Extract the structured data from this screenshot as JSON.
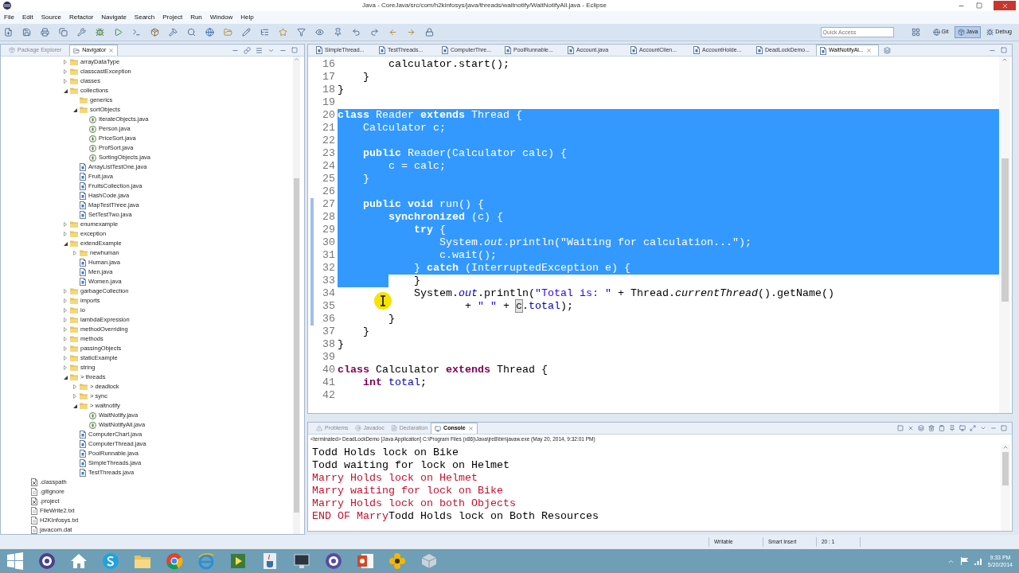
{
  "window": {
    "title": "Java - CoreJava/src/com/h2kinfosys/java/threads/waitnotify/WaitNotifyAll.java - Eclipse"
  },
  "menu": [
    "File",
    "Edit",
    "Source",
    "Refactor",
    "Navigate",
    "Search",
    "Project",
    "Run",
    "Window",
    "Help"
  ],
  "toolbar": {
    "quick_access": {
      "placeholder": "Quick Access"
    },
    "perspectives": [
      {
        "label": "Git",
        "selected": false
      },
      {
        "label": "Java",
        "selected": true
      },
      {
        "label": "Debug",
        "selected": false
      }
    ]
  },
  "navigator": {
    "tabs": [
      {
        "label": "Package Explorer",
        "selected": false
      },
      {
        "label": "Navigator",
        "selected": true
      }
    ],
    "folders": [
      {
        "label": "arrayDataType",
        "kind": "folder",
        "expanded": false
      },
      {
        "label": "classcastException",
        "kind": "folder",
        "expanded": false
      },
      {
        "label": "classes",
        "kind": "folder",
        "expanded": false
      },
      {
        "label": "collections",
        "kind": "folder",
        "expanded": true,
        "children": [
          {
            "label": "generics",
            "kind": "folder"
          },
          {
            "label": "sortObjects",
            "kind": "folder",
            "expanded": true,
            "children": [
              {
                "label": "IterateObjects.java",
                "kind": "class_file"
              },
              {
                "label": "Person.java",
                "kind": "class_file"
              },
              {
                "label": "PriceSort.java",
                "kind": "class_file"
              },
              {
                "label": "ProfSort.java",
                "kind": "class_file"
              },
              {
                "label": "SortingObjects.java",
                "kind": "class_file"
              }
            ]
          },
          {
            "label": "ArrayListTestOne.java",
            "kind": "java_file"
          },
          {
            "label": "Fruit.java",
            "kind": "java_file"
          },
          {
            "label": "FruitsCollection.java",
            "kind": "java_file"
          },
          {
            "label": "HashCode.java",
            "kind": "java_file"
          },
          {
            "label": "MapTestThree.java",
            "kind": "java_file"
          },
          {
            "label": "SetTestTwo.java",
            "kind": "java_file"
          }
        ]
      },
      {
        "label": "enumexample",
        "kind": "folder",
        "expanded": false
      },
      {
        "label": "exception",
        "kind": "folder",
        "expanded": false
      },
      {
        "label": "extendExample",
        "kind": "folder",
        "expanded": true,
        "children": [
          {
            "label": "newhuman",
            "kind": "folder",
            "expanded": false
          },
          {
            "label": "Human.java",
            "kind": "java_file"
          },
          {
            "label": "Men.java",
            "kind": "java_file"
          },
          {
            "label": "Women.java",
            "kind": "java_file"
          }
        ]
      },
      {
        "label": "garbageCollection",
        "kind": "folder",
        "expanded": false
      },
      {
        "label": "imports",
        "kind": "folder",
        "expanded": false
      },
      {
        "label": "io",
        "kind": "folder",
        "expanded": false
      },
      {
        "label": "lambdaExpression",
        "kind": "folder",
        "expanded": false
      },
      {
        "label": "methodOverriding",
        "kind": "folder",
        "expanded": false
      },
      {
        "label": "methods",
        "kind": "folder",
        "expanded": false
      },
      {
        "label": "passingObjects",
        "kind": "folder",
        "expanded": false
      },
      {
        "label": "staticExample",
        "kind": "folder",
        "expanded": false
      },
      {
        "label": "string",
        "kind": "folder",
        "expanded": false
      },
      {
        "label": "> threads",
        "kind": "folder",
        "expanded": true,
        "children": [
          {
            "label": "> deadlock",
            "kind": "folder",
            "expanded": false
          },
          {
            "label": "> sync",
            "kind": "folder",
            "expanded": false
          },
          {
            "label": "> waitnotify",
            "kind": "folder",
            "expanded": true,
            "children": [
              {
                "label": "WaitNotify.java",
                "kind": "class_file"
              },
              {
                "label": "WaitNotifyAll.java",
                "kind": "class_file"
              }
            ]
          },
          {
            "label": "ComputerChart.java",
            "kind": "java_file"
          },
          {
            "label": "ComputerThread.java",
            "kind": "java_file"
          },
          {
            "label": "PoolRunnable.java",
            "kind": "java_file"
          },
          {
            "label": "SimpleThreads.java",
            "kind": "java_file"
          },
          {
            "label": "TestThreads.java",
            "kind": "java_file"
          }
        ]
      }
    ],
    "project_files": [
      {
        "label": ".classpath",
        "kind": "settings_file"
      },
      {
        "label": ".gitignore",
        "kind": "text_file"
      },
      {
        "label": ".project",
        "kind": "settings_file"
      },
      {
        "label": "FileWrite2.txt",
        "kind": "text_file"
      },
      {
        "label": "H2KInfosys.txt",
        "kind": "text_file"
      },
      {
        "label": "javacom.dat",
        "kind": "text_file"
      }
    ]
  },
  "editor": {
    "tabs": [
      {
        "label": "SimpleThread...",
        "selected": false
      },
      {
        "label": "TestThreads...",
        "selected": false
      },
      {
        "label": "ComputerThre...",
        "selected": false
      },
      {
        "label": "PoolRunnable...",
        "selected": false
      },
      {
        "label": "Account.java",
        "selected": false
      },
      {
        "label": "AccountClien...",
        "selected": false
      },
      {
        "label": "AccountHolde...",
        "selected": false
      },
      {
        "label": "DeadLockDemo...",
        "selected": false
      },
      {
        "label": "WaitNotifyAl...",
        "selected": true
      }
    ],
    "lines": [
      {
        "number": "16",
        "selected": false,
        "selection_tail": false,
        "changed": false,
        "tokens": [
          {
            "text": "        calculator.start();",
            "kind": "plain"
          }
        ]
      },
      {
        "number": "17",
        "selected": false,
        "selection_tail": false,
        "changed": false,
        "tokens": [
          {
            "text": "    }",
            "kind": "plain"
          }
        ]
      },
      {
        "number": "18",
        "selected": false,
        "selection_tail": false,
        "changed": false,
        "tokens": [
          {
            "text": "}",
            "kind": "plain"
          }
        ]
      },
      {
        "number": "19",
        "selected": false,
        "selection_tail": false,
        "changed": false
      },
      {
        "number": "20",
        "selected": true,
        "selection_tail": false,
        "changed": false,
        "tokens": [
          {
            "text": "class",
            "kind": "keyword"
          },
          {
            "text": " Reader ",
            "kind": "plain"
          },
          {
            "text": "extends",
            "kind": "keyword"
          },
          {
            "text": " Thread {",
            "kind": "plain"
          }
        ]
      },
      {
        "number": "21",
        "selected": true,
        "selection_tail": false,
        "changed": false,
        "tokens": [
          {
            "text": "    Calculator c;",
            "kind": "plain"
          }
        ]
      },
      {
        "number": "22",
        "selected": true,
        "selection_tail": false,
        "changed": false
      },
      {
        "number": "23",
        "selected": true,
        "selection_tail": false,
        "changed": false,
        "tokens": [
          {
            "text": "    public",
            "kind": "keyword"
          },
          {
            "text": " Reader(Calculator calc) {",
            "kind": "plain"
          }
        ]
      },
      {
        "number": "24",
        "selected": true,
        "selection_tail": false,
        "changed": false,
        "tokens": [
          {
            "text": "        c = calc;",
            "kind": "plain"
          }
        ]
      },
      {
        "number": "25",
        "selected": true,
        "selection_tail": false,
        "changed": false,
        "tokens": [
          {
            "text": "    }",
            "kind": "plain"
          }
        ]
      },
      {
        "number": "26",
        "selected": true,
        "selection_tail": false,
        "changed": false
      },
      {
        "number": "27",
        "selected": true,
        "selection_tail": false,
        "changed": true,
        "tokens": [
          {
            "text": "    public void",
            "kind": "keyword"
          },
          {
            "text": " run() {",
            "kind": "plain"
          }
        ]
      },
      {
        "number": "28",
        "selected": true,
        "selection_tail": false,
        "changed": true,
        "tokens": [
          {
            "text": "        synchronized",
            "kind": "keyword"
          },
          {
            "text": " (c) {",
            "kind": "plain"
          }
        ]
      },
      {
        "number": "29",
        "selected": true,
        "selection_tail": false,
        "changed": true,
        "tokens": [
          {
            "text": "            try",
            "kind": "keyword"
          },
          {
            "text": " {",
            "kind": "plain"
          }
        ]
      },
      {
        "number": "30",
        "selected": true,
        "selection_tail": false,
        "changed": true,
        "tokens": [
          {
            "text": "                System.",
            "kind": "plain"
          },
          {
            "text": "out",
            "kind": "static_field"
          },
          {
            "text": ".println(",
            "kind": "plain"
          },
          {
            "text": "\"Waiting for calculation...\"",
            "kind": "string"
          },
          {
            "text": ");",
            "kind": "plain"
          }
        ]
      },
      {
        "number": "31",
        "selected": true,
        "selection_tail": false,
        "changed": true,
        "tokens": [
          {
            "text": "                c.wait();",
            "kind": "plain"
          }
        ]
      },
      {
        "number": "32",
        "selected": true,
        "selection_tail": false,
        "changed": true,
        "tokens": [
          {
            "text": "            } ",
            "kind": "plain"
          },
          {
            "text": "catch",
            "kind": "keyword"
          },
          {
            "text": " (InterruptedException e) {",
            "kind": "plain"
          }
        ]
      },
      {
        "number": "33",
        "selected": false,
        "selection_tail": true,
        "changed": true,
        "tokens": [
          {
            "text": "            }",
            "kind": "plain"
          }
        ]
      },
      {
        "number": "34",
        "selected": false,
        "selection_tail": false,
        "changed": true,
        "tokens": [
          {
            "text": "            System.",
            "kind": "plain"
          },
          {
            "text": "out",
            "kind": "static_field"
          },
          {
            "text": ".println(",
            "kind": "plain"
          },
          {
            "text": "\"Total is: \"",
            "kind": "string"
          },
          {
            "text": " + Thread.",
            "kind": "plain"
          },
          {
            "text": "currentThread",
            "kind": "static_method"
          },
          {
            "text": "().getName()",
            "kind": "plain"
          }
        ]
      },
      {
        "number": "35",
        "selected": false,
        "selection_tail": false,
        "changed": true,
        "tokens": [
          {
            "text": "                    + ",
            "kind": "plain"
          },
          {
            "text": "\" \"",
            "kind": "string"
          },
          {
            "text": " + ",
            "kind": "plain"
          },
          {
            "text": "c",
            "kind": "marked"
          },
          {
            "text": ".",
            "kind": "plain"
          },
          {
            "text": "total",
            "kind": "field"
          },
          {
            "text": ");",
            "kind": "plain"
          }
        ]
      },
      {
        "number": "36",
        "selected": false,
        "selection_tail": false,
        "changed": true,
        "tokens": [
          {
            "text": "        }",
            "kind": "plain"
          }
        ]
      },
      {
        "number": "37",
        "selected": false,
        "selection_tail": false,
        "changed": false,
        "tokens": [
          {
            "text": "    }",
            "kind": "plain"
          }
        ]
      },
      {
        "number": "38",
        "selected": false,
        "selection_tail": false,
        "changed": false,
        "tokens": [
          {
            "text": "}",
            "kind": "plain"
          }
        ]
      },
      {
        "number": "39",
        "selected": false,
        "selection_tail": false,
        "changed": false
      },
      {
        "number": "40",
        "selected": false,
        "selection_tail": false,
        "changed": false,
        "tokens": [
          {
            "text": "class",
            "kind": "keyword"
          },
          {
            "text": " Calculator ",
            "kind": "plain"
          },
          {
            "text": "extends",
            "kind": "keyword"
          },
          {
            "text": " Thread {",
            "kind": "plain"
          }
        ]
      },
      {
        "number": "41",
        "selected": false,
        "selection_tail": false,
        "changed": false,
        "tokens": [
          {
            "text": "    int",
            "kind": "keyword"
          },
          {
            "text": " total",
            "kind": "field"
          },
          {
            "text": ";",
            "kind": "plain"
          }
        ]
      },
      {
        "number": "42",
        "selected": false,
        "selection_tail": false,
        "changed": false
      }
    ]
  },
  "console": {
    "tabs": [
      {
        "label": "Problems",
        "selected": false
      },
      {
        "label": "Javadoc",
        "selected": false
      },
      {
        "label": "Declaration",
        "selected": false
      },
      {
        "label": "Console",
        "selected": true
      }
    ],
    "description": "<terminated> DeadLockDemo [Java Application] C:\\Program Files (x86)\\Java\\jre8\\bin\\javaw.exe (May 20, 2014, 9:32:01 PM)",
    "lines": [
      [
        {
          "text": "Todd Holds lock on Bike",
          "kind": "stdout"
        }
      ],
      [
        {
          "text": "Todd waiting for lock on Helmet",
          "kind": "stdout"
        }
      ],
      [
        {
          "text": "Marry Holds lock on Helmet",
          "kind": "stderr"
        }
      ],
      [
        {
          "text": "Marry waiting for lock on Bike",
          "kind": "stderr"
        }
      ],
      [
        {
          "text": "Marry Holds lock on both Objects",
          "kind": "stderr"
        }
      ],
      [
        {
          "text": "END OF Marry",
          "kind": "stderr"
        },
        {
          "text": "Todd Holds lock on Both Resources",
          "kind": "stdout"
        }
      ]
    ]
  },
  "status_bar": [
    "Writable",
    "Smart Insert",
    "20 : 1"
  ],
  "taskbar": {
    "time": "9:33 PM",
    "date": "5/20/2014"
  }
}
